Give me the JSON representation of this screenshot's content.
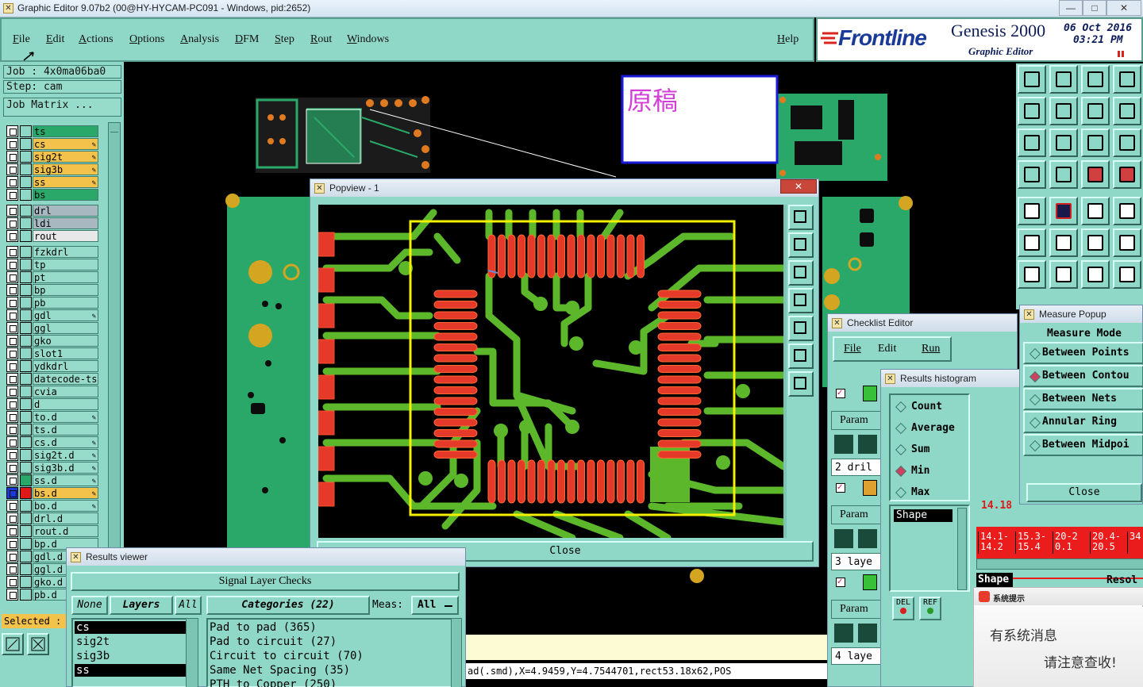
{
  "window": {
    "title": "Graphic Editor 9.07b2 (00@HY-HYCAM-PC091 - Windows, pid:2652)",
    "min": "—",
    "max": "□",
    "close": "✕"
  },
  "menu": {
    "items": [
      "File",
      "Edit",
      "Actions",
      "Options",
      "Analysis",
      "DFM",
      "Step",
      "Rout",
      "Windows"
    ],
    "help": "Help"
  },
  "logo": {
    "brand": "Frontline",
    "product": "Genesis 2000",
    "subtitle": "Graphic Editor",
    "date": "06 Oct 2016",
    "time": "03:21 PM"
  },
  "left": {
    "job": "Job : 4x0ma06ba0",
    "step": "Step: cam",
    "job_matrix": "Job Matrix ...",
    "selected": "Selected :",
    "layers": [
      {
        "name": "ts",
        "color": "#2aa86a",
        "pen": false
      },
      {
        "name": "cs",
        "color": "#f3c24a",
        "pen": true
      },
      {
        "name": "sig2t",
        "color": "#f3c24a",
        "pen": true
      },
      {
        "name": "sig3b",
        "color": "#f3c24a",
        "pen": true
      },
      {
        "name": "ss",
        "color": "#f3c24a",
        "pen": true
      },
      {
        "name": "bs",
        "color": "#2aa86a",
        "pen": false
      },
      {
        "name": "drl",
        "color": "#a8b8c0",
        "pen": false
      },
      {
        "name": "ldi",
        "color": "#a8b8c0",
        "pen": false
      },
      {
        "name": "rout",
        "color": "#e8e8e8",
        "pen": false
      },
      {
        "name": "fzkdrl",
        "color": "#97dccb",
        "pen": false
      },
      {
        "name": "tp",
        "color": "#97dccb",
        "pen": false
      },
      {
        "name": "pt",
        "color": "#97dccb",
        "pen": false
      },
      {
        "name": "bp",
        "color": "#97dccb",
        "pen": false
      },
      {
        "name": "pb",
        "color": "#97dccb",
        "pen": false
      },
      {
        "name": "gdl",
        "color": "#97dccb",
        "pen": true
      },
      {
        "name": "ggl",
        "color": "#97dccb",
        "pen": false
      },
      {
        "name": "gko",
        "color": "#97dccb",
        "pen": false
      },
      {
        "name": "slot1",
        "color": "#97dccb",
        "pen": false
      },
      {
        "name": "ydkdrl",
        "color": "#97dccb",
        "pen": false
      },
      {
        "name": "datecode-ts",
        "color": "#97dccb",
        "pen": false
      },
      {
        "name": "cvia",
        "color": "#97dccb",
        "pen": false
      },
      {
        "name": "d",
        "color": "#97dccb",
        "pen": false
      },
      {
        "name": "to.d",
        "color": "#97dccb",
        "pen": true
      },
      {
        "name": "ts.d",
        "color": "#97dccb",
        "pen": false
      },
      {
        "name": "cs.d",
        "color": "#97dccb",
        "pen": true
      },
      {
        "name": "sig2t.d",
        "color": "#97dccb",
        "pen": true
      },
      {
        "name": "sig3b.d",
        "color": "#97dccb",
        "pen": true
      },
      {
        "name": "ss.d",
        "color": "#97dccb",
        "pen": true
      },
      {
        "name": "bs.d",
        "color": "#97dccb",
        "pen": true
      },
      {
        "name": "bo.d",
        "color": "#97dccb",
        "pen": true
      },
      {
        "name": "drl.d",
        "color": "#97dccb",
        "pen": false
      },
      {
        "name": "rout.d",
        "color": "#97dccb",
        "pen": false
      },
      {
        "name": "bp.d",
        "color": "#97dccb",
        "pen": false
      },
      {
        "name": "gdl.d",
        "color": "#97dccb",
        "pen": false
      },
      {
        "name": "ggl.d",
        "color": "#97dccb",
        "pen": false
      },
      {
        "name": "gko.d",
        "color": "#97dccb",
        "pen": false
      },
      {
        "name": "pb.d",
        "color": "#97dccb",
        "pen": false
      }
    ]
  },
  "annotation": {
    "text": "原稿"
  },
  "popview": {
    "title": "Popview - 1",
    "close": "Close"
  },
  "results_viewer": {
    "title": "Results viewer",
    "header": "Signal Layer Checks",
    "btn_none": "None",
    "btn_layers": "Layers",
    "btn_all": "All",
    "categories_label": "Categories (22)",
    "meas_label": "Meas:",
    "meas_value": "All",
    "layers": [
      "cs",
      "sig2t",
      "sig3b",
      "ss"
    ],
    "categories": [
      "Pad to pad (365)",
      "Pad to circuit (27)",
      "Circuit to circuit (70)",
      "Same Net Spacing (35)",
      "PTH to Copper (250)"
    ]
  },
  "status": {
    "text": "ad(.smd),X=4.9459,Y=4.7544701,rect53.18x62,POS"
  },
  "checklist": {
    "title": "Checklist Editor",
    "menu": [
      "File",
      "Edit",
      "Run"
    ],
    "param": "Param",
    "rows": [
      "2 dril",
      "3 laye",
      "4 laye"
    ]
  },
  "histogram": {
    "title": "Results histogram",
    "options": [
      {
        "label": "Count",
        "selected": false
      },
      {
        "label": "Average",
        "selected": false
      },
      {
        "label": "Sum",
        "selected": false
      },
      {
        "label": "Min",
        "selected": true
      },
      {
        "label": "Max",
        "selected": false
      }
    ],
    "list_item": "Shape",
    "del": "DEL",
    "ref": "REF",
    "value": "14.18",
    "bins": [
      "14.1-14.2",
      "15.3-15.4",
      "20-20.1",
      "20.4-20.5",
      "34"
    ],
    "shape_label": "Shape",
    "resol_label": "Resol"
  },
  "measure": {
    "title": "Measure Popup",
    "mode_label": "Measure Mode",
    "options": [
      {
        "label": "Between Points",
        "selected": false
      },
      {
        "label": "Between Contou",
        "selected": true
      },
      {
        "label": "Between Nets",
        "selected": false
      },
      {
        "label": "Annular Ring",
        "selected": false
      },
      {
        "label": "Between Midpoi",
        "selected": false
      }
    ],
    "close": "Close"
  },
  "notification": {
    "title": "系统提示",
    "line1": "有系统消息",
    "line2": "请注意查收!"
  }
}
